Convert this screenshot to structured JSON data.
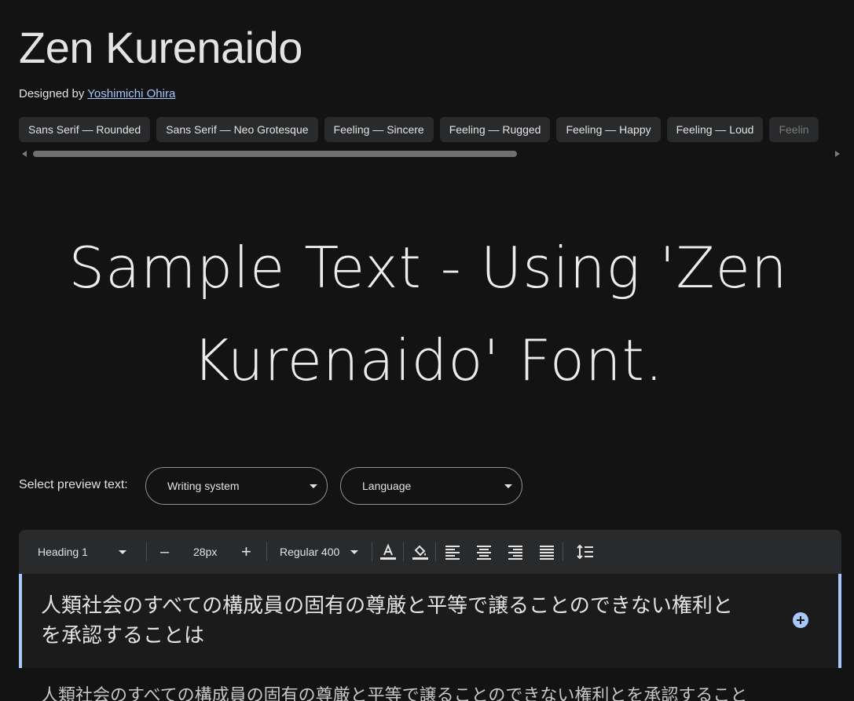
{
  "font": {
    "name": "Zen Kurenaido",
    "designed_by_label": "Designed by",
    "designer": "Yoshimichi Ohira"
  },
  "tags": [
    "Sans Serif — Rounded",
    "Sans Serif — Neo Grotesque",
    "Feeling — Sincere",
    "Feeling — Rugged",
    "Feeling — Happy",
    "Feeling — Loud",
    "Feelin"
  ],
  "sample": {
    "line1": "Sample Text - Using 'Zen",
    "line2": "Kurenaido' Font."
  },
  "preview": {
    "label": "Select preview text:",
    "writing_system": "Writing system",
    "language": "Language"
  },
  "toolbar": {
    "style": "Heading 1",
    "decrease": "–",
    "size": "28px",
    "increase": "+",
    "weight": "Regular 400",
    "icons": [
      "text-color-icon",
      "highlight-icon",
      "align-left-icon",
      "align-center-icon",
      "align-right-icon",
      "align-justify-icon",
      "line-spacing-icon"
    ]
  },
  "editor": {
    "heading_text": "人類社会のすべての構成員の固有の尊厳と平等で譲ることのできない権利とを承認することは",
    "body_text": "人類社会のすべての構成員の固有の尊厳と平等で譲ることのできない権利とを承認すること"
  },
  "colors": {
    "background": "#131314",
    "surface": "#282a2c",
    "accent": "#a8c7fa",
    "text": "#e3e3e3"
  }
}
